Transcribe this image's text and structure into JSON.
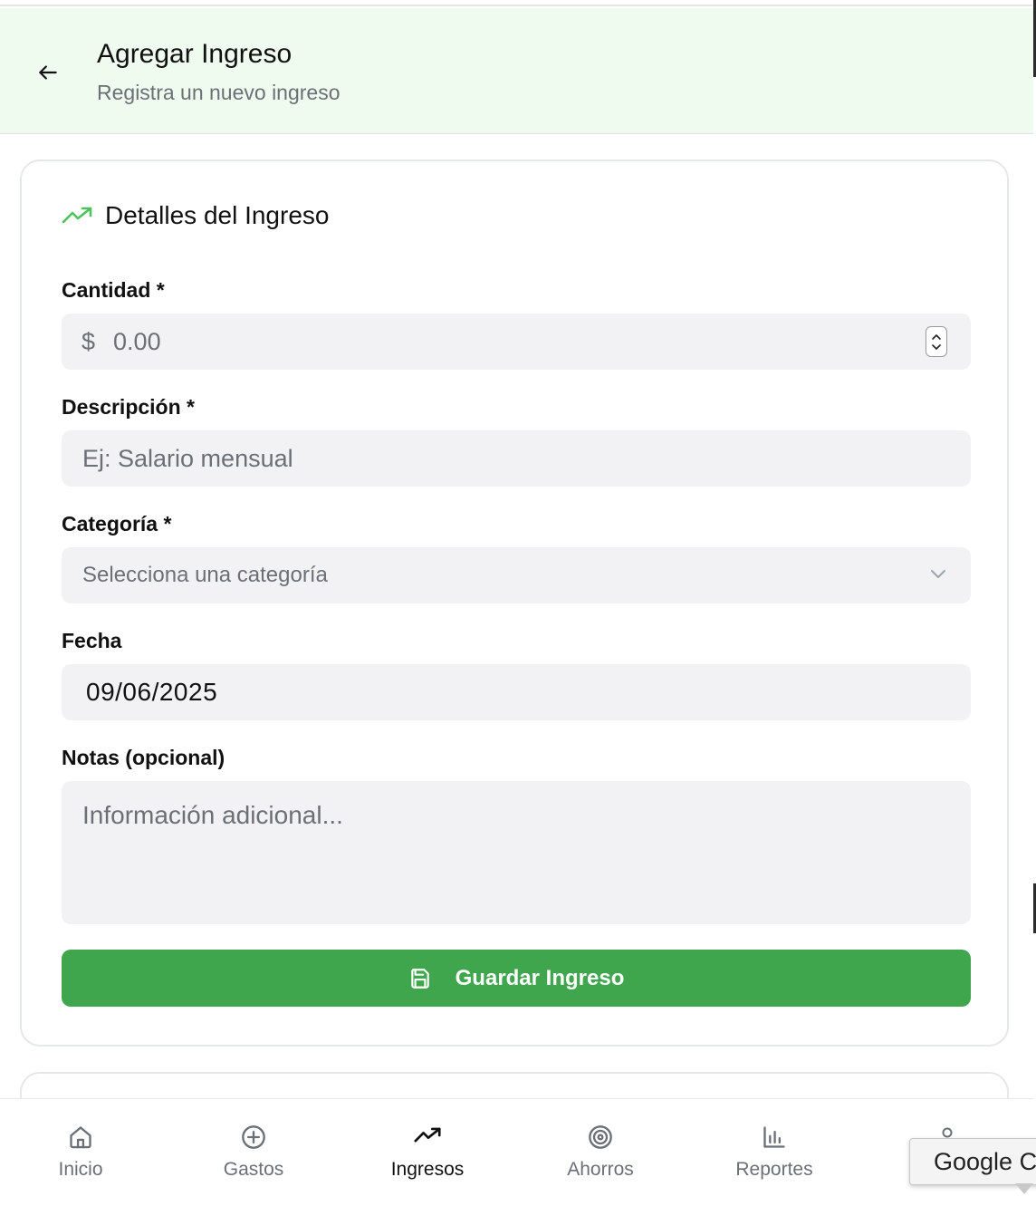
{
  "header": {
    "title": "Agregar Ingreso",
    "subtitle": "Registra un nuevo ingreso",
    "back_icon": "arrow-left-icon"
  },
  "form": {
    "section_title": "Detalles del Ingreso",
    "section_icon": "trending-up-icon",
    "amount": {
      "label": "Cantidad *",
      "currency": "$",
      "placeholder": "0.00"
    },
    "description": {
      "label": "Descripción *",
      "placeholder": "Ej: Salario mensual"
    },
    "category": {
      "label": "Categoría *",
      "placeholder": "Selecciona una categoría"
    },
    "date": {
      "label": "Fecha",
      "value": "09/06/2025"
    },
    "notes": {
      "label": "Notas (opcional)",
      "placeholder": "Información adicional..."
    },
    "save_button": {
      "label": "Guardar Ingreso",
      "icon": "save-icon"
    }
  },
  "bottom_nav": {
    "items": [
      {
        "label": "Inicio",
        "icon": "home-icon",
        "active": false
      },
      {
        "label": "Gastos",
        "icon": "plus-circle-icon",
        "active": false
      },
      {
        "label": "Ingresos",
        "icon": "trending-up-icon",
        "active": true
      },
      {
        "label": "Ahorros",
        "icon": "target-icon",
        "active": false
      },
      {
        "label": "Reportes",
        "icon": "bar-chart-icon",
        "active": false
      }
    ]
  },
  "tooltip": {
    "text": "Google C"
  },
  "colors": {
    "accent_green": "#3fa64d",
    "header_bg": "#f0fbf0",
    "icon_green": "#4cc35a",
    "field_bg": "#f2f2f4"
  }
}
